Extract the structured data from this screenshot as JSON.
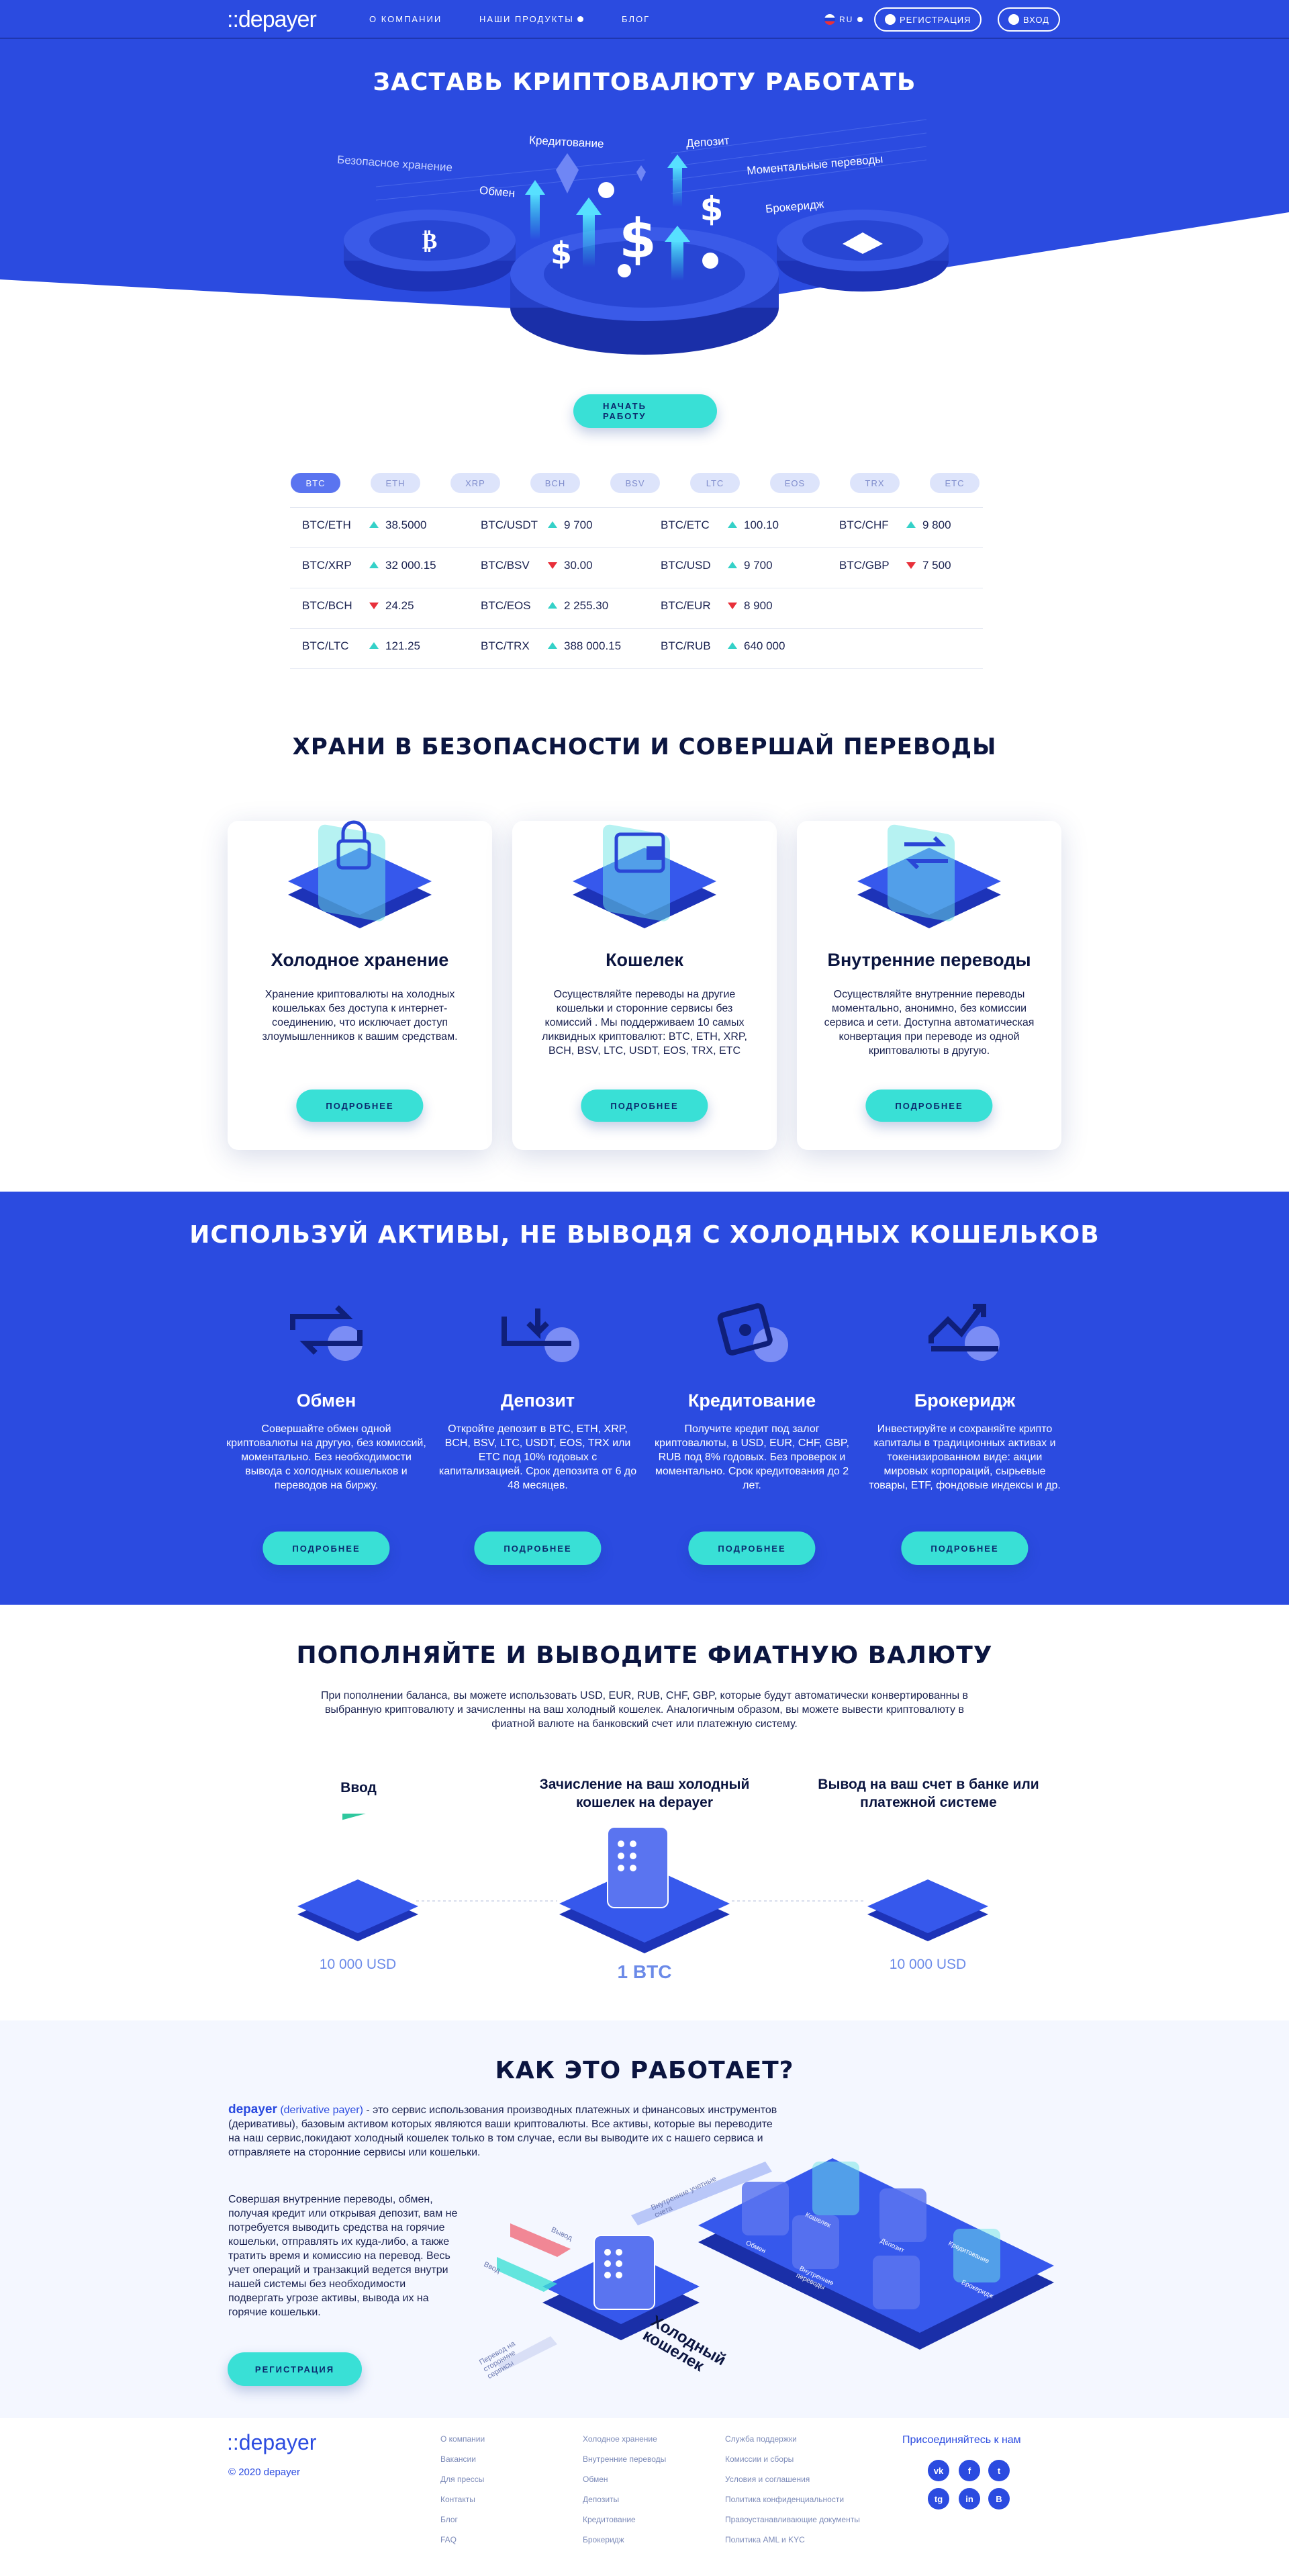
{
  "header": {
    "logo": "::depayer",
    "nav": [
      "О КОМПАНИИ",
      "НАШИ ПРОДУКТЫ",
      "БЛОГ"
    ],
    "lang": "RU",
    "register": "РЕГИСТРАЦИЯ",
    "login": "ВХОД"
  },
  "hero": {
    "title": "ЗАСТАВЬ КРИПТОВАЛЮТУ РАБОТАТЬ",
    "labels": {
      "safe": "Безопасное хранение",
      "credit": "Кредитование",
      "deposit": "Депозит",
      "instant": "Моментальные переводы",
      "exchange": "Обмен",
      "brokerage": "Брокеридж"
    },
    "cta": "НАЧАТЬ РАБОТУ"
  },
  "ticker": {
    "tabs": [
      "BTC",
      "ETH",
      "XRP",
      "BCH",
      "BSV",
      "LTC",
      "EOS",
      "TRX",
      "ETC"
    ],
    "columns": [
      [
        {
          "pair": "BTC/ETH",
          "dir": "up",
          "val": "38.5000"
        },
        {
          "pair": "BTC/XRP",
          "dir": "up",
          "val": "32 000.15"
        },
        {
          "pair": "BTC/BCH",
          "dir": "down",
          "val": "24.25"
        },
        {
          "pair": "BTC/LTC",
          "dir": "up",
          "val": "121.25"
        }
      ],
      [
        {
          "pair": "BTC/USDT",
          "dir": "up",
          "val": "9 700"
        },
        {
          "pair": "BTC/BSV",
          "dir": "down",
          "val": "30.00"
        },
        {
          "pair": "BTC/EOS",
          "dir": "up",
          "val": "2 255.30"
        },
        {
          "pair": "BTC/TRX",
          "dir": "up",
          "val": "388 000.15"
        }
      ],
      [
        {
          "pair": "BTC/ETC",
          "dir": "up",
          "val": "100.10"
        },
        {
          "pair": "BTC/USD",
          "dir": "up",
          "val": "9 700"
        },
        {
          "pair": "BTC/EUR",
          "dir": "down",
          "val": "8 900"
        },
        {
          "pair": "BTC/RUB",
          "dir": "up",
          "val": "640 000"
        }
      ],
      [
        {
          "pair": "BTC/CHF",
          "dir": "up",
          "val": "9 800"
        },
        {
          "pair": "BTC/GBP",
          "dir": "down",
          "val": "7 500"
        }
      ]
    ]
  },
  "store": {
    "title": "ХРАНИ В БЕЗОПАСНОСТИ И СОВЕРШАЙ ПЕРЕВОДЫ",
    "cards": [
      {
        "title": "Холодное хранение",
        "text": "Хранение криптовалюты на холодных кошельках без доступа к интернет-соединению, что исключает доступ злоумышленников к вашим средствам.",
        "btn": "ПОДРОБНЕЕ"
      },
      {
        "title": "Кошелек",
        "text": "Осуществляйте переводы на другие кошельки и сторонние сервисы без комиссий . Мы поддерживаем 10 самых ликвидных криптовалют: BTC, ETH, XRP, BCH, BSV, LTC, USDT, EOS, TRX, ETC",
        "btn": "ПОДРОБНЕЕ"
      },
      {
        "title": "Внутренние переводы",
        "text": "Осуществляйте внутренние переводы моментально, анонимно, без комиссии сервиса и сети. Доступна автоматическая конвертация при переводе из одной криптовалюты в другую.",
        "btn": "ПОДРОБНЕЕ"
      }
    ]
  },
  "assets": {
    "title": "ИСПОЛЬЗУЙ АКТИВЫ, НЕ ВЫВОДЯ С ХОЛОДНЫХ КОШЕЛЬКОВ",
    "items": [
      {
        "title": "Обмен",
        "text": "Совершайте обмен одной криптовалюты на другую, без комиссий, моментально. Без необходимости вывода с холодных кошельков и переводов на биржу.",
        "btn": "ПОДРОБНЕЕ"
      },
      {
        "title": "Депозит",
        "text": "Откройте депозит в BTC, ETH, XRP, BCH, BSV,  LTC, USDT, EOS, TRX или ETC под 10% годовых с капитализацией. Срок депозита от 6 до 48 месяцев.",
        "btn": "ПОДРОБНЕЕ"
      },
      {
        "title": "Кредитование",
        "text": "Получите кредит под залог криптовалюты, в USD, EUR, CHF, GBP, RUB  под 8% годовых. Без проверок и моментально. Срок кредитования до 2 лет.",
        "btn": "ПОДРОБНЕЕ"
      },
      {
        "title": "Брокеридж",
        "text": "Инвестируйте и сохраняйте крипто капиталы в традиционных активах и токенизированном виде: акции мировых корпораций, сырьевые товары, ETF, фондовые индексы и др.",
        "btn": "ПОДРОБНЕЕ"
      }
    ]
  },
  "fiat": {
    "title": "ПОПОЛНЯЙТЕ И ВЫВОДИТЕ ФИАТНУЮ ВАЛЮТУ",
    "text": "При пополнении баланса, вы можете использовать USD, EUR, RUB, CHF, GBP,  которые будут автоматически конвертированны в выбранную криптовалюту и зачисленны на ваш холодный кошелек. Аналогичным образом, вы можете вывести криптовалюту в фиатной валюте на банковский счет или платежную систему.",
    "steps": [
      {
        "caption": "Ввод",
        "amount": "10 000 USD"
      },
      {
        "caption": "Зачисление на ваш  холодный кошелек  на depayer",
        "amount": "1 BTC"
      },
      {
        "caption": "Вывод на ваш счет в банке или платежной системе",
        "amount": "10 000 USD"
      }
    ]
  },
  "how": {
    "title": "КАК ЭТО РАБОТАЕТ?",
    "brand": "depayer",
    "brand_sub": "(derivative payer)",
    "intro": " - это сервис использования производных  платежных и финансовых инструментов (деривативы),  базовым активом которых являются ваши криптовалюты.  Все активы, которые вы переводите на наш сервис,покидают  холодный кошелек только в том случае, если вы выводите их с нашего сервиса и отправляете на сторонние сервисы или кошельки.",
    "text": "Совершая внутренние переводы, обмен, получая кредит или открывая депозит, вам не потребуется выводить средства на горячие кошельки, отправлять их куда-либо, а также тратить время и комиссию на перевод. Весь учет операций и транзакций  ведется внутри нашей системы без необходимости подвергать угрозе активы, вывода их на горячие кошельки.",
    "btn": "РЕГИСТРАЦИЯ",
    "labels": {
      "cold": "Холодный кошелек",
      "in": "Ввод",
      "out": "Вывод",
      "internal": "Внутренние учетные счета",
      "external": "Перевод на сторонние сервисы",
      "wallet": "Кошелек",
      "deposit": "Депозит",
      "exchange": "Обмен",
      "brokerage": "Брокеридж",
      "credit": "Кредитование",
      "transfers": "Внутренние переводы"
    }
  },
  "footer": {
    "logo": "::depayer",
    "copy": "© 2020 depayer",
    "col1": [
      "О компании",
      "Вакансии",
      "Для прессы",
      "Контакты",
      "Блог",
      "FAQ"
    ],
    "col2": [
      "Холодное хранение",
      "Внутренние переводы",
      "Обмен",
      "Депозиты",
      "Кредитование",
      "Брокеридж"
    ],
    "col3": [
      "Служба поддержки",
      "Комиссии и сборы",
      "Условия и соглашения",
      "Политика конфиденциальности",
      "Правоустанавливающие документы",
      "Политика AML и KYC"
    ],
    "join": "Присоединяйтесь к нам",
    "social": [
      "vk",
      "f",
      "t",
      "tg",
      "in",
      "B"
    ]
  }
}
